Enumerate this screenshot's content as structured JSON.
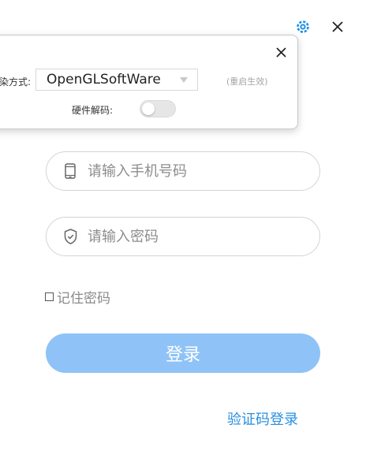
{
  "popup": {
    "render_label": "渲染方式:",
    "render_value": "OpenGLSoftWare",
    "restart_note": "(重启生效)",
    "hwdecode_label": "硬件解码:",
    "hwdecode_on": false
  },
  "form": {
    "phone_placeholder": "请输入手机号码",
    "password_placeholder": "请输入密码",
    "remember_label": "记住密码",
    "remember_checked": false,
    "login_label": "登录",
    "sms_login_label": "验证码登录"
  },
  "icons": {
    "settings": "gear-icon",
    "close": "close-icon",
    "popup_close": "close-icon",
    "phone": "phone-icon",
    "shield": "shield-check-icon"
  },
  "colors": {
    "accent": "#2a8fe0",
    "login_button": "#8fc3f7"
  }
}
